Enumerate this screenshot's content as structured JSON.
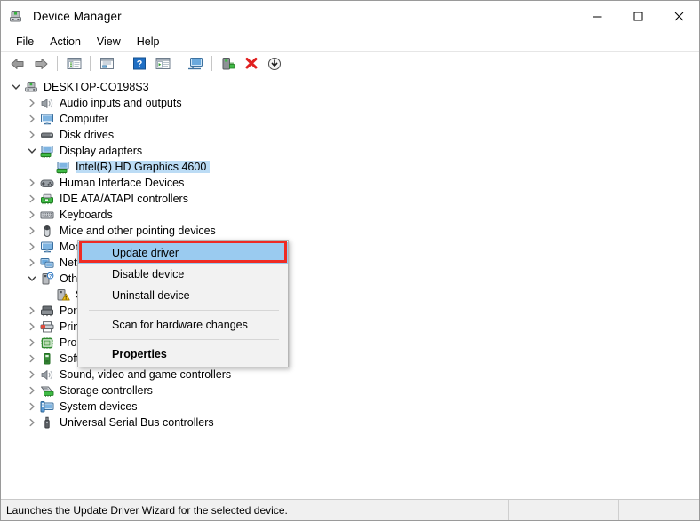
{
  "window": {
    "title": "Device Manager",
    "title_icon": "device-manager-icon",
    "minimize_label": "–",
    "maximize_label": "☐",
    "close_label": "✕"
  },
  "menubar": {
    "items": [
      {
        "label": "File",
        "name": "menu-file"
      },
      {
        "label": "Action",
        "name": "menu-action"
      },
      {
        "label": "View",
        "name": "menu-view"
      },
      {
        "label": "Help",
        "name": "menu-help"
      }
    ]
  },
  "toolbar": {
    "buttons": [
      {
        "name": "back-icon",
        "title": "Back"
      },
      {
        "name": "forward-icon",
        "title": "Forward"
      },
      {
        "name": "show-hide-console-tree-icon",
        "title": "Show/Hide Console Tree"
      },
      {
        "name": "properties-icon",
        "title": "Properties"
      },
      {
        "name": "help-icon",
        "title": "Help"
      },
      {
        "name": "scan-icon",
        "title": "Scan for hardware changes"
      },
      {
        "name": "update-driver-icon",
        "title": "Update driver"
      },
      {
        "name": "uninstall-device-icon",
        "title": "Uninstall device"
      },
      {
        "name": "disable-device-icon",
        "title": "Disable device"
      }
    ]
  },
  "tree": {
    "root": {
      "label": "DESKTOP-CO198S3",
      "icon": "computer-root-icon",
      "expanded": true
    },
    "items": [
      {
        "label": "Audio inputs and outputs",
        "icon": "speaker-icon",
        "indent": 1,
        "expanded": false,
        "selected": false
      },
      {
        "label": "Computer",
        "icon": "monitor-icon",
        "indent": 1,
        "expanded": false,
        "selected": false
      },
      {
        "label": "Disk drives",
        "icon": "disk-drive-icon",
        "indent": 1,
        "expanded": false,
        "selected": false
      },
      {
        "label": "Display adapters",
        "icon": "display-adapter-icon",
        "indent": 1,
        "expanded": true,
        "selected": false
      },
      {
        "label": "Intel(R) HD Graphics 4600",
        "icon": "display-adapter-icon",
        "indent": 2,
        "expanded": null,
        "selected": true
      },
      {
        "label": "Human Interface Devices",
        "icon": "gamepad-icon",
        "indent": 1,
        "expanded": false,
        "selected": false
      },
      {
        "label": "IDE ATA/ATAPI controllers",
        "icon": "ide-controller-icon",
        "indent": 1,
        "expanded": false,
        "selected": false
      },
      {
        "label": "Keyboards",
        "icon": "keyboard-icon",
        "indent": 1,
        "expanded": false,
        "selected": false
      },
      {
        "label": "Mice and other pointing devices",
        "icon": "mouse-icon",
        "indent": 1,
        "expanded": false,
        "selected": false
      },
      {
        "label": "Monitors",
        "icon": "monitor-icon",
        "indent": 1,
        "expanded": false,
        "selected": false
      },
      {
        "label": "Network adapters",
        "icon": "network-adapter-icon",
        "indent": 1,
        "expanded": false,
        "selected": false
      },
      {
        "label": "Other devices",
        "icon": "unknown-device-icon",
        "indent": 1,
        "expanded": true,
        "selected": false
      },
      {
        "label": "SM Bus Controller",
        "icon": "warning-device-icon",
        "indent": 2,
        "expanded": null,
        "selected": false
      },
      {
        "label": "Ports (COM & LPT)",
        "icon": "port-icon",
        "indent": 1,
        "expanded": false,
        "selected": false
      },
      {
        "label": "Print queues",
        "icon": "printer-icon",
        "indent": 1,
        "expanded": false,
        "selected": false
      },
      {
        "label": "Processors",
        "icon": "processor-icon",
        "indent": 1,
        "expanded": false,
        "selected": false
      },
      {
        "label": "Software devices",
        "icon": "software-device-icon",
        "indent": 1,
        "expanded": false,
        "selected": false
      },
      {
        "label": "Sound, video and game controllers",
        "icon": "speaker-icon",
        "indent": 1,
        "expanded": false,
        "selected": false
      },
      {
        "label": "Storage controllers",
        "icon": "storage-controller-icon",
        "indent": 1,
        "expanded": false,
        "selected": false
      },
      {
        "label": "System devices",
        "icon": "system-device-icon",
        "indent": 1,
        "expanded": false,
        "selected": false
      },
      {
        "label": "Universal Serial Bus controllers",
        "icon": "usb-icon",
        "indent": 1,
        "expanded": false,
        "selected": false
      }
    ]
  },
  "context_menu": {
    "items": [
      {
        "label": "Update driver",
        "highlighted": true,
        "bold": false,
        "separator_after": false
      },
      {
        "label": "Disable device",
        "highlighted": false,
        "bold": false,
        "separator_after": false
      },
      {
        "label": "Uninstall device",
        "highlighted": false,
        "bold": false,
        "separator_after": true
      },
      {
        "label": "Scan for hardware changes",
        "highlighted": false,
        "bold": false,
        "separator_after": true
      },
      {
        "label": "Properties",
        "highlighted": false,
        "bold": true,
        "separator_after": false
      }
    ],
    "highlight_color": "#9acbf0",
    "annotation_color": "#ef2b24"
  },
  "statusbar": {
    "message": "Launches the Update Driver Wizard for the selected device.",
    "pane2": "",
    "pane3": ""
  }
}
